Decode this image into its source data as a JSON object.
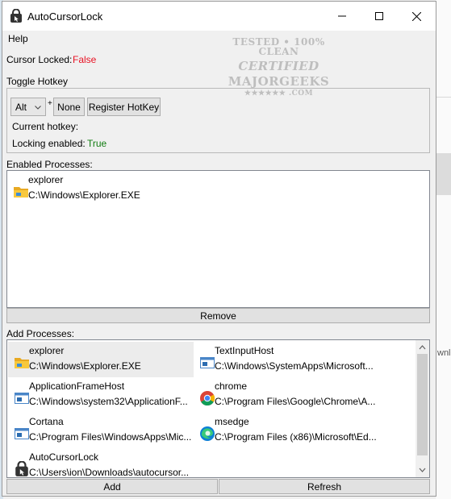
{
  "window": {
    "title": "AutoCursorLock",
    "minimize_label": "Minimize",
    "maximize_label": "Maximize",
    "close_label": "Close"
  },
  "menu": {
    "help": "Help"
  },
  "status": {
    "cursor_locked_label": "Cursor Locked:",
    "cursor_locked_value": "False",
    "false_color": "#e81123",
    "true_color": "#107c10"
  },
  "hotkey": {
    "section_label": "Toggle Hotkey",
    "modifier_value": "Alt",
    "plus": "+",
    "key_button": "None",
    "register_button": "Register HotKey",
    "current_label": "Current hotkey:",
    "locking_label": "Locking enabled:",
    "locking_value": "True"
  },
  "enabled": {
    "label": "Enabled Processes:",
    "items": [
      {
        "name": "explorer",
        "path": "C:\\Windows\\Explorer.EXE",
        "icon": "folder-icon"
      }
    ],
    "remove_button": "Remove"
  },
  "add": {
    "label": "Add Processes:",
    "items": [
      {
        "name": "explorer",
        "path": "C:\\Windows\\Explorer.EXE",
        "icon": "folder-icon"
      },
      {
        "name": "TextInputHost",
        "path": "C:\\Windows\\SystemApps\\Microsoft...",
        "icon": "window-icon"
      },
      {
        "name": "ApplicationFrameHost",
        "path": "C:\\Windows\\system32\\ApplicationF...",
        "icon": "window-icon"
      },
      {
        "name": "chrome",
        "path": "C:\\Program Files\\Google\\Chrome\\A...",
        "icon": "chrome-icon"
      },
      {
        "name": "Cortana",
        "path": "C:\\Program Files\\WindowsApps\\Mic...",
        "icon": "window-icon"
      },
      {
        "name": "msedge",
        "path": "C:\\Program Files (x86)\\Microsoft\\Ed...",
        "icon": "edge-icon"
      },
      {
        "name": "AutoCursorLock",
        "path": "C:\\Users\\ion\\Downloads\\autocursor...",
        "icon": "lock-app-icon"
      }
    ],
    "add_button": "Add",
    "refresh_button": "Refresh"
  },
  "watermark": {
    "line1": "TESTED • 100% CLEAN",
    "line2": "CERTIFIED",
    "line3": "MAJORGEEKS",
    "line4": "★★★★★★ .COM"
  },
  "background": {
    "partial_text": "wnlo"
  }
}
